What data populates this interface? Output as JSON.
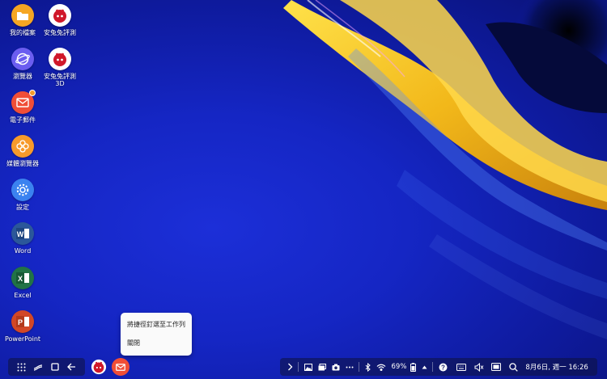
{
  "desktop": {
    "icons": [
      {
        "label": "我的檔案",
        "icon": "folder-icon",
        "color": "#f5a623"
      },
      {
        "label": "安兔兔評測",
        "icon": "antutu-icon",
        "color": "#d0182a"
      },
      {
        "label": "瀏覽器",
        "icon": "browser-icon",
        "color": "#6b5df0"
      },
      {
        "label": "安兔兔評測\n3D",
        "icon": "antutu-3d-icon",
        "color": "#d0182a"
      },
      {
        "label": "電子郵件",
        "icon": "email-icon",
        "color": "#f04e37"
      },
      {
        "label": "媒體瀏覽器",
        "icon": "media-browser-icon",
        "color": "#f79a2b"
      },
      {
        "label": "設定",
        "icon": "settings-icon",
        "color": "#3b82f0"
      },
      {
        "label": "Word",
        "icon": "word-icon",
        "color": "#2b579a"
      },
      {
        "label": "Excel",
        "icon": "excel-icon",
        "color": "#217346"
      },
      {
        "label": "PowerPoint",
        "icon": "powerpoint-icon",
        "color": "#d24726"
      }
    ]
  },
  "context_menu": {
    "items": [
      {
        "label": "將捷徑釘選至工作列"
      },
      {
        "label": "關閉"
      }
    ]
  },
  "taskbar": {
    "left_buttons": [
      "apps-grid-icon",
      "recent-apps-icon",
      "home-icon",
      "back-icon"
    ],
    "running_apps": [
      "antutu-icon",
      "email-icon"
    ],
    "status": {
      "battery_percent": "69%",
      "datetime": "8月6日, 週一 16:26"
    },
    "status_icons": [
      "chevron-right-icon",
      "gallery-icon",
      "screenshot-icon",
      "camera-icon",
      "more-icon",
      "bluetooth-icon",
      "wifi-icon",
      "battery-icon",
      "caret-up-icon",
      "help-icon",
      "keyboard-icon",
      "volume-mute-icon",
      "screen-capture-icon",
      "search-icon"
    ]
  },
  "colors": {
    "accent_yellow": "#f2c21b",
    "wallpaper_blue": "#1526c4",
    "notification_badge": "#f29b2b"
  }
}
